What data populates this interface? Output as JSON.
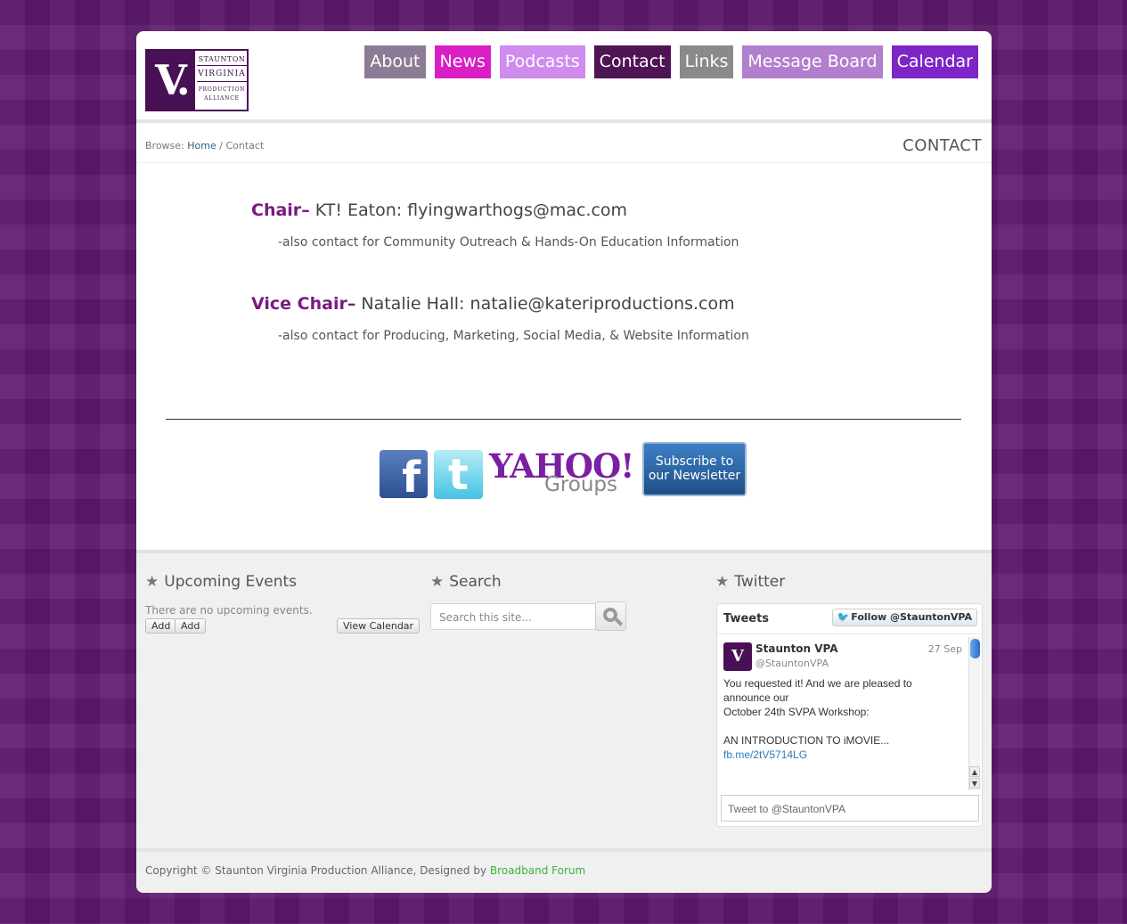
{
  "logo": {
    "mark": "V.",
    "line1": "STAUNTON",
    "line2": "VIRGINIA",
    "line3a": "PRODUCTION",
    "line3b": "ALLIANCE"
  },
  "nav": [
    {
      "label": "About",
      "color": "#8c7b94"
    },
    {
      "label": "News",
      "color": "#d91fc4"
    },
    {
      "label": "Podcasts",
      "color": "#cf8bed"
    },
    {
      "label": "Contact",
      "color": "#4e1454"
    },
    {
      "label": "Links",
      "color": "#8a8a8a"
    },
    {
      "label": "Message Board",
      "color": "#b27fcf"
    },
    {
      "label": "Calendar",
      "color": "#7e25c8"
    }
  ],
  "breadcrumb": {
    "prefix": "Browse:",
    "home": "Home",
    "separator": "/",
    "current": "Contact"
  },
  "page_title": "CONTACT",
  "contacts": [
    {
      "role": "Chair",
      "dash": "–",
      "detail": " KT! Eaton: flyingwarthogs@mac.com",
      "note": "-also contact for Community Outreach & Hands-On Education Information"
    },
    {
      "role": "Vice Chair",
      "dash": "–",
      "detail": " Natalie Hall: natalie@kateriproductions.com",
      "note": "-also contact for Producing, Marketing, Social Media, & Website Information"
    }
  ],
  "social": {
    "facebook_glyph": "f",
    "twitter_glyph": "t",
    "yahoo_word": "YAHOO!",
    "yahoo_sub": "Groups",
    "newsletter_line1": "Subscribe to",
    "newsletter_line2": "our Newsletter"
  },
  "widgets": {
    "events": {
      "title": "Upcoming Events",
      "empty": "There are no upcoming events.",
      "add1": "Add",
      "add2": "Add",
      "view_calendar": "View Calendar"
    },
    "search": {
      "title": "Search",
      "placeholder": "Search this site..."
    },
    "twitter": {
      "title": "Twitter",
      "header": "Tweets",
      "follow": "Follow @StauntonVPA",
      "tweet": {
        "name": "Staunton VPA",
        "handle": "@StauntonVPA",
        "date": "27 Sep",
        "text": "You requested it!  And we are pleased to announce our\nOctober 24th SVPA Workshop:\n\nAN INTRODUCTION TO iMOVIE...",
        "link": "fb.me/2tV5714LG"
      },
      "compose": "Tweet to @StauntonVPA"
    }
  },
  "footer": {
    "copyright": "Copyright © Staunton Virginia Production Alliance, Designed by ",
    "designer": "Broadband Forum"
  }
}
